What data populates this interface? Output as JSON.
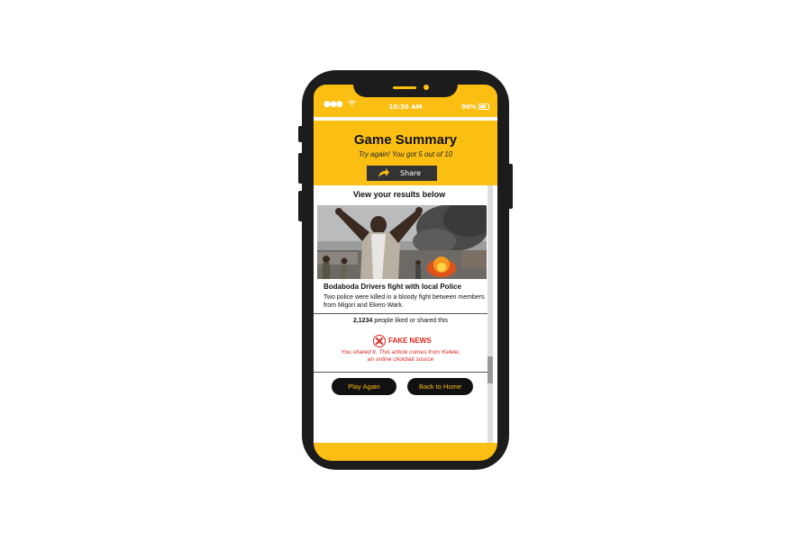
{
  "status_bar": {
    "time": "10:30 AM",
    "battery": "90%",
    "icons": [
      "signal-dots-icon",
      "wifi-icon",
      "battery-icon"
    ]
  },
  "header": {
    "title": "Game Summary",
    "subtitle": "Try again! You got 5 out of 10",
    "share_label": "Share",
    "share_icon": "share-arrow-icon"
  },
  "results": {
    "heading": "View your results below",
    "article": {
      "title": "Bodaboda Drivers fight with local Police",
      "description": "Two police were killed in a bloody fight between members from Migori and Ekero Wark."
    },
    "likes_count": "2,1234",
    "likes_text": " people liked or shared this",
    "verdict": "FAKE NEWS",
    "verdict_icon": "x-circle-icon",
    "verdict_message_1": "You shared it. This article comes from Kelele,",
    "verdict_message_2": "an online clickbait source"
  },
  "actions": {
    "play_again": "Play Again",
    "back_home": "Back to Home"
  },
  "colors": {
    "accent_yellow": "#fbbf14",
    "frame": "#1c1c1c",
    "fake_red": "#d8251d",
    "button_dark": "#111111"
  }
}
